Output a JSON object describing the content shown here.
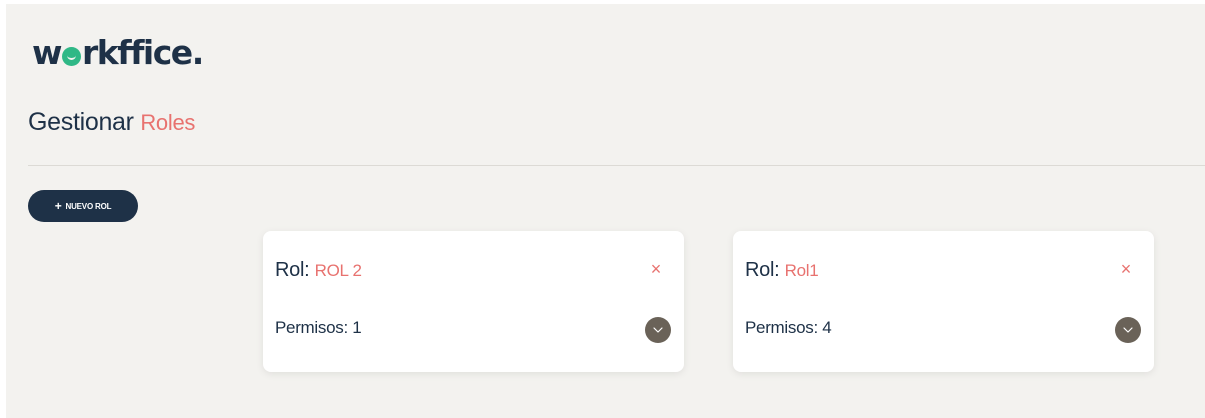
{
  "brand": {
    "logo_text_before": "w",
    "logo_text_after": "rkffice.",
    "colors": {
      "primary": "#1e3147",
      "accent": "#e8726f",
      "logo_mark": "#2fb886",
      "background": "#f3f2ef",
      "chevron_button": "#6a6258"
    }
  },
  "header": {
    "title_main": "Gestionar",
    "title_accent": "Roles"
  },
  "toolbar": {
    "new_role_icon": "+",
    "new_role_label": "NUEVO ROL"
  },
  "roles": [
    {
      "role_prefix": "Rol:",
      "name": "ROL 2",
      "permissions_text": "Permisos: 1",
      "close_icon": "×",
      "expand_icon": "chevron-down-icon"
    },
    {
      "role_prefix": "Rol:",
      "name": "Rol1",
      "permissions_text": "Permisos: 4",
      "close_icon": "×",
      "expand_icon": "chevron-down-icon"
    }
  ]
}
